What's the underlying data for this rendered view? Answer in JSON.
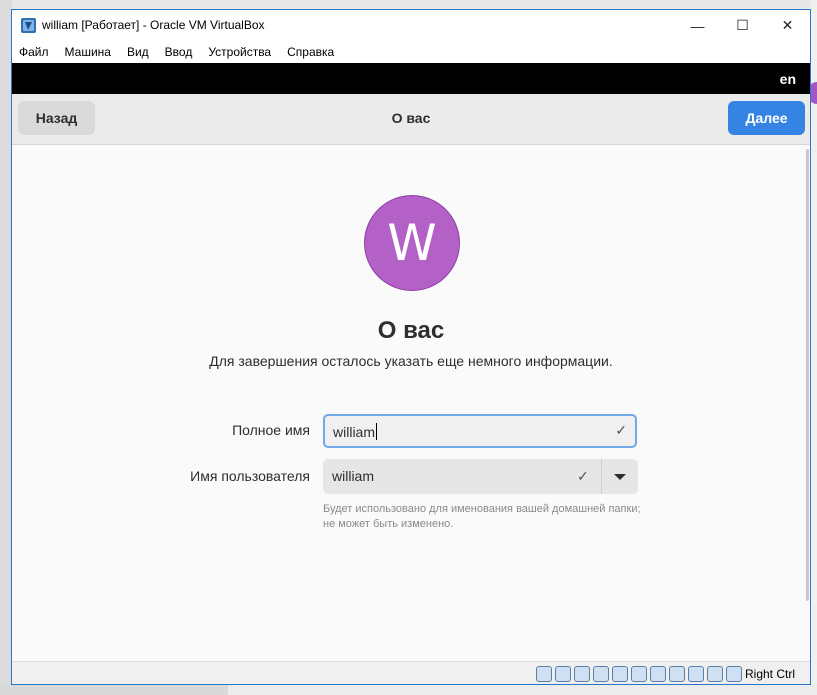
{
  "window": {
    "title": "william [Работает] - Oracle VM VirtualBox",
    "min_glyph": "—",
    "max_glyph": "☐",
    "close_glyph": "✕"
  },
  "menu": [
    "Файл",
    "Машина",
    "Вид",
    "Ввод",
    "Устройства",
    "Справка"
  ],
  "guest": {
    "language": "en",
    "header": {
      "back_label": "Назад",
      "title": "О вас",
      "next_label": "Далее"
    },
    "avatar_letter": "W",
    "avatar_color": "#b461c7",
    "heading": "О вас",
    "subheading": "Для завершения осталось указать еще немного информации.",
    "full_name": {
      "label": "Полное имя",
      "value": "william"
    },
    "username": {
      "label": "Имя пользователя",
      "value": "william"
    },
    "username_hint": "Будет использовано для именования вашей домашней папки; не может быть изменено.",
    "check_glyph": "✓",
    "accent_color": "#3584e4"
  },
  "statusbar": {
    "icons": [
      "hard-disk-icon",
      "optical-drive-icon",
      "audio-icon",
      "network-icon",
      "usb-icon",
      "shared-folders-icon",
      "display-icon",
      "recording-icon",
      "cpu-icon",
      "vt-x-icon",
      "mouse-integration-icon",
      "keyboard-icon"
    ],
    "host_key": "Right Ctrl"
  }
}
